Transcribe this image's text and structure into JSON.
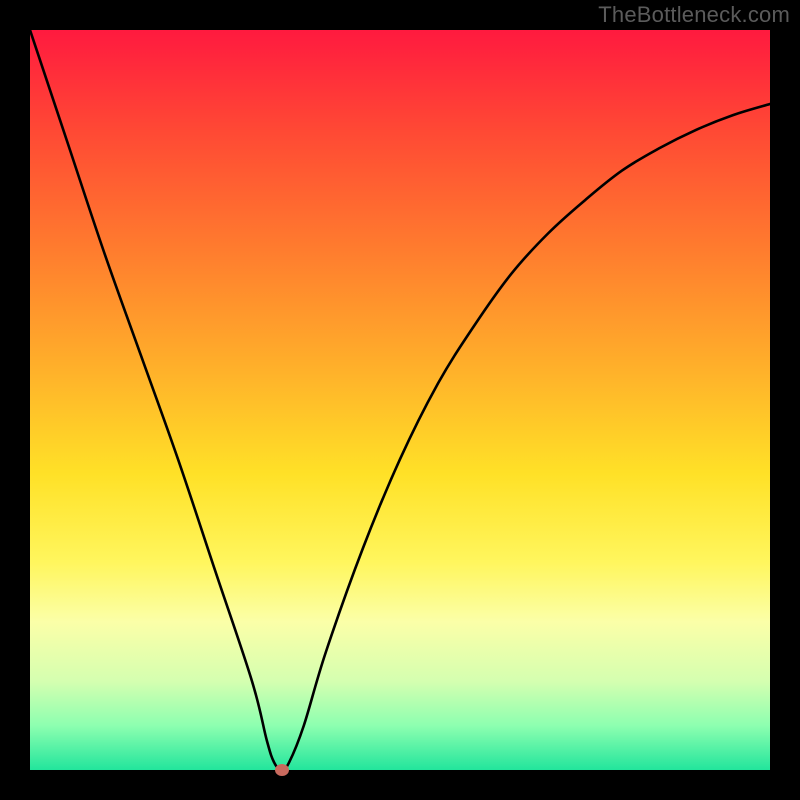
{
  "watermark": "TheBottleneck.com",
  "colors": {
    "frame_bg": "#000000",
    "curve_stroke": "#000000",
    "marker_fill": "#c96a5e",
    "gradient_stops": [
      {
        "pct": 0,
        "color": "#ff1a3f"
      },
      {
        "pct": 14,
        "color": "#ff4a34"
      },
      {
        "pct": 30,
        "color": "#ff7d2e"
      },
      {
        "pct": 46,
        "color": "#ffb12a"
      },
      {
        "pct": 60,
        "color": "#ffe127"
      },
      {
        "pct": 72,
        "color": "#fff65e"
      },
      {
        "pct": 80,
        "color": "#fbffa8"
      },
      {
        "pct": 88,
        "color": "#d5ffb0"
      },
      {
        "pct": 94,
        "color": "#8dffb0"
      },
      {
        "pct": 100,
        "color": "#22e59c"
      }
    ]
  },
  "chart_data": {
    "type": "line",
    "title": "",
    "xlabel": "",
    "ylabel": "",
    "xlim": [
      0,
      100
    ],
    "ylim": [
      0,
      100
    ],
    "marker": {
      "x": 34,
      "y": 0
    },
    "series": [
      {
        "name": "bottleneck-curve",
        "x": [
          0,
          5,
          10,
          15,
          20,
          25,
          30,
          32,
          33,
          34,
          35,
          37,
          40,
          45,
          50,
          55,
          60,
          65,
          70,
          75,
          80,
          85,
          90,
          95,
          100
        ],
        "values": [
          100,
          85,
          70,
          56,
          42,
          27,
          12,
          4,
          1,
          0,
          1,
          6,
          16,
          30,
          42,
          52,
          60,
          67,
          72.5,
          77,
          81,
          84,
          86.5,
          88.5,
          90
        ]
      }
    ]
  }
}
